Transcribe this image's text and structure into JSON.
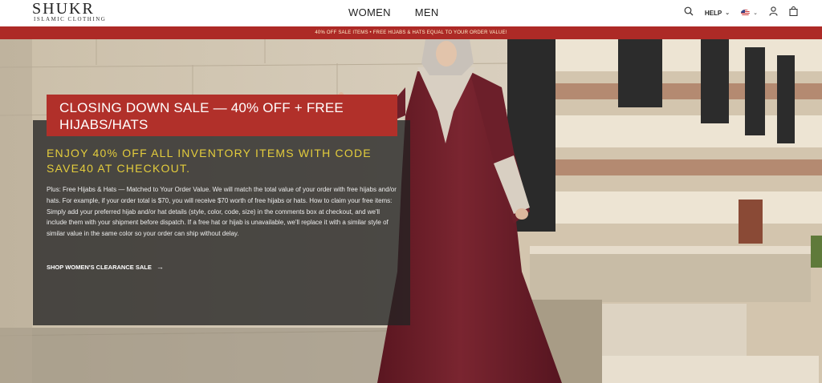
{
  "header": {
    "logo": {
      "name": "SHUKR",
      "tagline": "ISLAMIC CLOTHING"
    },
    "nav": [
      "WOMEN",
      "MEN"
    ],
    "help_label": "HELP",
    "icons": [
      "search-icon",
      "flag-us-icon",
      "user-icon",
      "bag-icon"
    ]
  },
  "promo_bar": {
    "text": "40% OFF SALE ITEMS • FREE HIJABS & HATS EQUAL TO YOUR ORDER VALUE!",
    "bg_color": "#ad2a26"
  },
  "hero": {
    "banner_title": "CLOSING DOWN SALE — 40% OFF + FREE HIJABS/HATS",
    "headline": "ENJOY 40% OFF ALL INVENTORY ITEMS WITH CODE SAVE40 AT CHECKOUT.",
    "body": "Plus: Free Hijabs & Hats — Matched to Your Order Value. We will match the total value of your order with free hijabs and/or hats. For example, if your order total is $70, you will receive $70 worth of free hijabs or hats. How to claim your free items: Simply add your preferred hijab and/or hat details (style, color, code, size) in the comments box at checkout, and we'll include them with your shipment before dispatch. If a free hat or hijab is unavailable, we'll replace it with a similar style of similar value in the same color so your order can ship without delay.",
    "cta_label": "SHOP WOMEN'S CLEARANCE SALE",
    "colors": {
      "banner": "#b1302a",
      "headline": "#e3cc3c",
      "dress": "#6a1c24"
    }
  }
}
